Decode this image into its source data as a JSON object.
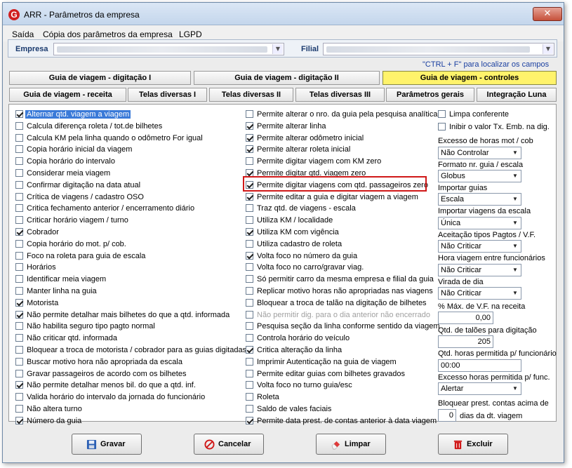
{
  "window": {
    "title": "ARR - Parâmetros da empresa",
    "close": "✕",
    "app_icon": "G"
  },
  "menu": [
    {
      "label": "Saída"
    },
    {
      "label": "Cópia dos parâmetros da empresa"
    },
    {
      "label": "LGPD"
    }
  ],
  "filters": {
    "empresa_label": "Empresa",
    "filial_label": "Filial",
    "hint": "\"CTRL + F\" para localizar os campos"
  },
  "tabs_row1": [
    {
      "label": "Guia de viagem - digitação I"
    },
    {
      "label": "Guia de viagem - digitação II"
    },
    {
      "label": "Guia de viagem - controles",
      "active": true
    }
  ],
  "tabs_row2": [
    {
      "label": "Guia de viagem - receita"
    },
    {
      "label": "Telas diversas I"
    },
    {
      "label": "Telas diversas II"
    },
    {
      "label": "Telas diversas III"
    },
    {
      "label": "Parâmetros gerais"
    },
    {
      "label": "Integração Luna"
    }
  ],
  "col1": [
    {
      "label": "Alternar qtd. viagem a viagem",
      "checked": true,
      "selected": true
    },
    {
      "label": "Calcula diferença roleta / tot.de bilhetes",
      "checked": false
    },
    {
      "label": "Calcula KM pela linha quando o odômetro For igual",
      "checked": false
    },
    {
      "label": "Copia horário inicial da viagem",
      "checked": false
    },
    {
      "label": "Copia horário do intervalo",
      "checked": false
    },
    {
      "label": "Considerar meia viagem",
      "checked": false
    },
    {
      "label": "Confirmar digitação na data atual",
      "checked": false
    },
    {
      "label": "Crítica de viagens / cadastro OSO",
      "checked": false
    },
    {
      "label": "Critica fechamento anterior / encerramento diário",
      "checked": false
    },
    {
      "label": "Criticar horário viagem / turno",
      "checked": false
    },
    {
      "label": "Cobrador",
      "checked": true
    },
    {
      "label": "Copia horário do mot. p/ cob.",
      "checked": false
    },
    {
      "label": "Foco na roleta para guia de escala",
      "checked": false
    },
    {
      "label": "Horários",
      "checked": false
    },
    {
      "label": "Identificar meia viagem",
      "checked": false
    },
    {
      "label": "Manter linha na guia",
      "checked": false
    },
    {
      "label": "Motorista",
      "checked": true
    },
    {
      "label": "Não permite detalhar mais bilhetes do que a qtd. informada",
      "checked": true
    },
    {
      "label": "Não habilita seguro tipo pagto normal",
      "checked": false
    },
    {
      "label": "Não criticar qtd. informada",
      "checked": false
    },
    {
      "label": "Bloquear a troca de motorista / cobrador para as guias digitadas",
      "checked": false
    },
    {
      "label": "Buscar motivo hora não apropriada da escala",
      "checked": false
    },
    {
      "label": "Gravar passageiros de acordo com os bilhetes",
      "checked": false
    },
    {
      "label": "Não permite detalhar menos bil. do que a qtd. inf.",
      "checked": true
    },
    {
      "label": "Valida horário do intervalo da jornada do funcionário",
      "checked": false
    },
    {
      "label": "Não altera turno",
      "checked": false
    },
    {
      "label": "Número da guia",
      "checked": true
    }
  ],
  "col2": [
    {
      "label": "Permite alterar o nro. da guia pela pesquisa analítica",
      "checked": false
    },
    {
      "label": "Permite alterar linha",
      "checked": true
    },
    {
      "label": "Permite alterar odômetro inicial",
      "checked": true
    },
    {
      "label": "Permite alterar roleta inicial",
      "checked": true
    },
    {
      "label": "Permite digitar viagem com KM zero",
      "checked": false
    },
    {
      "label": "Permite digitar qtd. viagem zero",
      "checked": true
    },
    {
      "label": "Permite digitar viagens com qtd. passageiros zero",
      "checked": true
    },
    {
      "label": "Permite editar a guia e digitar viagem a viagem",
      "checked": true
    },
    {
      "label": "Traz qtd. de viagens - escala",
      "checked": false
    },
    {
      "label": "Utiliza KM / localidade",
      "checked": false
    },
    {
      "label": "Utiliza KM com vigência",
      "checked": true
    },
    {
      "label": "Utiliza cadastro de roleta",
      "checked": false
    },
    {
      "label": "Volta foco no número da guia",
      "checked": true
    },
    {
      "label": "Volta foco no carro/gravar viag.",
      "checked": false
    },
    {
      "label": "Só permitir carro  da mesma empresa e filial da guia",
      "checked": false
    },
    {
      "label": "Replicar motivo horas não apropriadas nas viagens",
      "checked": false
    },
    {
      "label": "Bloquear a troca de talão na digitação de bilhetes",
      "checked": false
    },
    {
      "label": "Não permitir dig. para o dia anterior não encerrado",
      "checked": false,
      "disabled": true
    },
    {
      "label": "Pesquisa seção da linha conforme sentido da viagem",
      "checked": false
    },
    {
      "label": "Controla horário do veículo",
      "checked": false
    },
    {
      "label": "Critica alteração da linha",
      "checked": true
    },
    {
      "label": "Imprimir Autenticação na guia de viagem",
      "checked": false
    },
    {
      "label": "Permite editar guias com bilhetes gravados",
      "checked": false
    },
    {
      "label": "Volta foco no turno guia/esc",
      "checked": false
    },
    {
      "label": "Roleta",
      "checked": false
    },
    {
      "label": "Saldo de vales faciais",
      "checked": false
    },
    {
      "label": "Permite data prest. de contas anterior à data viagem",
      "checked": true
    }
  ],
  "col3_checks": [
    {
      "label": "Limpa conferente",
      "checked": false
    },
    {
      "label": "Inibir o valor Tx. Emb. na dig.",
      "checked": false
    }
  ],
  "col3_selects": [
    {
      "label": "Excesso de horas mot / cob",
      "value": "Não Controlar"
    },
    {
      "label": "Formato nr. guia / escala",
      "value": "Globus"
    },
    {
      "label": "Importar guias",
      "value": "Escala"
    },
    {
      "label": "Importar viagens  da  escala",
      "value": "Única"
    },
    {
      "label": "Aceitação tipos Pagtos / V.F.",
      "value": "Não Criticar"
    },
    {
      "label": "Hora viagem entre funcionários",
      "value": "Não Criticar"
    },
    {
      "label": "Virada de dia",
      "value": "Não Criticar"
    }
  ],
  "col3_fields": {
    "pct_label": "% Máx. de V.F. na receita",
    "pct_value": "0,00",
    "taloes_label": "Qtd. de talões para digitação",
    "taloes_value": "205",
    "horas_label": "Qtd. horas permitida p/ funcionário",
    "horas_value": "00:00",
    "excesso_label": "Excesso horas permitida p/ func.",
    "excesso_value": "Alertar",
    "bloq_label": "Bloquear prest. contas acima de",
    "bloq_value": "0",
    "bloq_suffix": "dias da dt. viagem"
  },
  "buttons": [
    {
      "label": "Gravar",
      "icon": "floppy-disk-icon"
    },
    {
      "label": "Cancelar",
      "icon": "cancel-circle-icon"
    },
    {
      "label": "Limpar",
      "icon": "eraser-icon"
    },
    {
      "label": "Excluir",
      "icon": "trash-icon"
    }
  ]
}
